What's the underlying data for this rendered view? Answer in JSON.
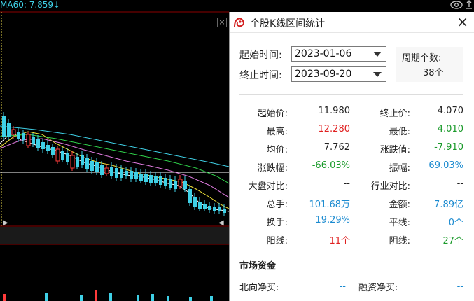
{
  "chart": {
    "ma_label": "MA60: 7.859",
    "ma_arrow": "↓",
    "close_glyph": "×",
    "colors": {
      "up": "#ff3b3b",
      "down": "#3fd0e6",
      "ma5": "#ffffff",
      "ma10": "#f5e63a",
      "ma20": "#e07be0",
      "ma30": "#2fd14a",
      "ma60": "#3fd0e6"
    }
  },
  "dialog": {
    "title": "个股K线区间统计",
    "close": "×",
    "start_label": "起始时间:",
    "start_value": "2023-01-06",
    "end_label": "终止时间:",
    "end_value": "2023-09-20",
    "period_label": "周期个数:",
    "period_value": "38个",
    "stats": {
      "open_label": "起始价:",
      "open_value": "11.980",
      "close_label": "终止价:",
      "close_value": "4.070",
      "high_label": "最高:",
      "high_value": "12.280",
      "low_label": "最低:",
      "low_value": "4.010",
      "avg_label": "均价:",
      "avg_value": "7.762",
      "change_label": "涨跌值:",
      "change_value": "-7.910",
      "pct_label": "涨跌幅:",
      "pct_value": "-66.03%",
      "amp_label": "振幅:",
      "amp_value": "69.03%",
      "market_cmp_label": "大盘对比:",
      "market_cmp_value": "--",
      "industry_cmp_label": "行业对比:",
      "industry_cmp_value": "--",
      "vol_label": "总手:",
      "vol_value": "101.68万",
      "amount_label": "金额:",
      "amount_value": "7.89亿",
      "turnover_label": "换手:",
      "turnover_value": "19.29%",
      "flat_label": "平线:",
      "flat_value": "0个",
      "yang_label": "阳线:",
      "yang_value": "11个",
      "yin_label": "阴线:",
      "yin_value": "27个"
    },
    "market_title": "市场资金",
    "north_label": "北向净买:",
    "north_value": "--",
    "margin_label": "融资净买:",
    "margin_value": "--"
  }
}
